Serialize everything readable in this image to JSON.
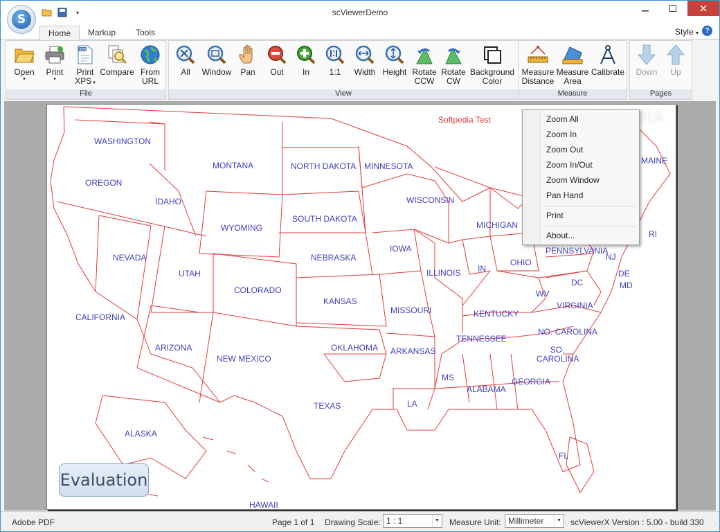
{
  "window": {
    "title": "scViewerDemo"
  },
  "quick_access": {
    "icons": [
      "open-folder-icon",
      "save-icon",
      "customize-dropdown-icon"
    ]
  },
  "tabs": [
    {
      "label": "Home"
    },
    {
      "label": "Markup"
    },
    {
      "label": "Tools"
    }
  ],
  "style_menu": {
    "label": "Style"
  },
  "ribbon": {
    "groups": {
      "file": "File",
      "view": "View",
      "measure": "Measure",
      "pages": "Pages"
    },
    "file": [
      {
        "line1": "Open",
        "line2": "",
        "icon": "folder-icon",
        "dropdown": true
      },
      {
        "line1": "Print",
        "line2": "",
        "icon": "printer-icon",
        "dropdown": true
      },
      {
        "line1": "Print",
        "line2": "XPS",
        "icon": "xps-icon",
        "dropdown": true
      },
      {
        "line1": "Compare",
        "line2": "",
        "icon": "compare-icon",
        "dropdown": false
      },
      {
        "line1": "From",
        "line2": "URL",
        "icon": "globe-icon",
        "dropdown": false
      }
    ],
    "view": [
      {
        "line1": "All",
        "line2": "",
        "icon": "zoom-all-icon"
      },
      {
        "line1": "Window",
        "line2": "",
        "icon": "zoom-window-icon"
      },
      {
        "line1": "Pan",
        "line2": "",
        "icon": "pan-hand-icon"
      },
      {
        "line1": "Out",
        "line2": "",
        "icon": "zoom-out-icon"
      },
      {
        "line1": "In",
        "line2": "",
        "icon": "zoom-in-icon"
      },
      {
        "line1": "1:1",
        "line2": "",
        "icon": "zoom-actual-icon"
      },
      {
        "line1": "Width",
        "line2": "",
        "icon": "fit-width-icon"
      },
      {
        "line1": "Height",
        "line2": "",
        "icon": "fit-height-icon"
      },
      {
        "line1": "Rotate",
        "line2": "CCW",
        "icon": "rotate-ccw-icon"
      },
      {
        "line1": "Rotate",
        "line2": "CW",
        "icon": "rotate-cw-icon"
      },
      {
        "line1": "Background",
        "line2": "Color",
        "icon": "background-color-icon"
      }
    ],
    "measure": [
      {
        "line1": "Measure",
        "line2": "Distance",
        "icon": "ruler-icon"
      },
      {
        "line1": "Measure",
        "line2": "Area",
        "icon": "area-icon"
      },
      {
        "line1": "Calibrate",
        "line2": "",
        "icon": "compass-icon"
      }
    ],
    "pages": [
      {
        "line1": "Down",
        "line2": "",
        "icon": "arrow-down-icon"
      },
      {
        "line1": "Up",
        "line2": "",
        "icon": "arrow-up-icon"
      }
    ]
  },
  "document": {
    "test_label": "Softpedia Test",
    "watermark": "SOFTPEDIA",
    "evaluation_badge": "Evaluation",
    "states": [
      {
        "name": "WASHINGTON",
        "key": "wa"
      },
      {
        "name": "OREGON",
        "key": "or"
      },
      {
        "name": "IDAHO",
        "key": "id"
      },
      {
        "name": "MONTANA",
        "key": "mt"
      },
      {
        "name": "NORTH DAKOTA",
        "key": "nd"
      },
      {
        "name": "MINNESOTA",
        "key": "mn"
      },
      {
        "name": "WISCONSIN",
        "key": "wi"
      },
      {
        "name": "MICHIGAN",
        "key": "mi"
      },
      {
        "name": "MAINE",
        "key": "me"
      },
      {
        "name": "SOUTH DAKOTA",
        "key": "sd"
      },
      {
        "name": "WYOMING",
        "key": "wy"
      },
      {
        "name": "NEBRASKA",
        "key": "ne"
      },
      {
        "name": "IOWA",
        "key": "ia"
      },
      {
        "name": "ILLINOIS",
        "key": "il"
      },
      {
        "name": "IN",
        "key": "in"
      },
      {
        "name": "OHIO",
        "key": "oh"
      },
      {
        "name": "PENNSYLVANIA",
        "key": "pa"
      },
      {
        "name": "NJ",
        "key": "nj"
      },
      {
        "name": "DE",
        "key": "de"
      },
      {
        "name": "MD",
        "key": "md"
      },
      {
        "name": "RI",
        "key": "ri"
      },
      {
        "name": "NEVADA",
        "key": "nv"
      },
      {
        "name": "UTAH",
        "key": "ut"
      },
      {
        "name": "COLORADO",
        "key": "co"
      },
      {
        "name": "KANSAS",
        "key": "ks"
      },
      {
        "name": "MISSOURI",
        "key": "mo"
      },
      {
        "name": "KENTUCKY",
        "key": "ky"
      },
      {
        "name": "WV",
        "key": "wv"
      },
      {
        "name": "DC",
        "key": "dc"
      },
      {
        "name": "VIRGINIA",
        "key": "va"
      },
      {
        "name": "CALIFORNIA",
        "key": "ca"
      },
      {
        "name": "ARIZONA",
        "key": "az"
      },
      {
        "name": "NEW MEXICO",
        "key": "nm"
      },
      {
        "name": "OKLAHOMA",
        "key": "ok"
      },
      {
        "name": "ARKANSAS",
        "key": "ar"
      },
      {
        "name": "TENNESSEE",
        "key": "tn"
      },
      {
        "name": "NO. CAROLINA",
        "key": "nc"
      },
      {
        "name": "SO. CAROLINA",
        "key": "sc"
      },
      {
        "name": "MS",
        "key": "ms"
      },
      {
        "name": "ALABAMA",
        "key": "al"
      },
      {
        "name": "GEORGIA",
        "key": "ga"
      },
      {
        "name": "TEXAS",
        "key": "tx"
      },
      {
        "name": "LA",
        "key": "la"
      },
      {
        "name": "FL",
        "key": "fl"
      },
      {
        "name": "ALASKA",
        "key": "ak"
      },
      {
        "name": "HAWAII",
        "key": "hi"
      }
    ],
    "colors": {
      "borders": "#e23a3a",
      "labels": "#4040c0"
    }
  },
  "context_menu": {
    "items": [
      {
        "label": "Zoom All",
        "key": "zoom-all"
      },
      {
        "label": "Zoom In",
        "key": "zoom-in"
      },
      {
        "label": "Zoom Out",
        "key": "zoom-out"
      },
      {
        "label": "Zoom In/Out",
        "key": "zoom-in-out"
      },
      {
        "label": "Zoom Window",
        "key": "zoom-window"
      },
      {
        "label": "Pan Hand",
        "key": "pan-hand"
      },
      {
        "label": "Print",
        "key": "print"
      },
      {
        "label": "About...",
        "key": "about"
      }
    ]
  },
  "status": {
    "file_type": "Adobe PDF",
    "page_info": "Page 1 of 1",
    "drawing_scale_label": "Drawing Scale:",
    "drawing_scale_value": "1 : 1",
    "measure_unit_label": "Measure Unit:",
    "measure_unit_value": "Millimeter",
    "version": "scViewerX Version : 5.00 - build 330"
  }
}
